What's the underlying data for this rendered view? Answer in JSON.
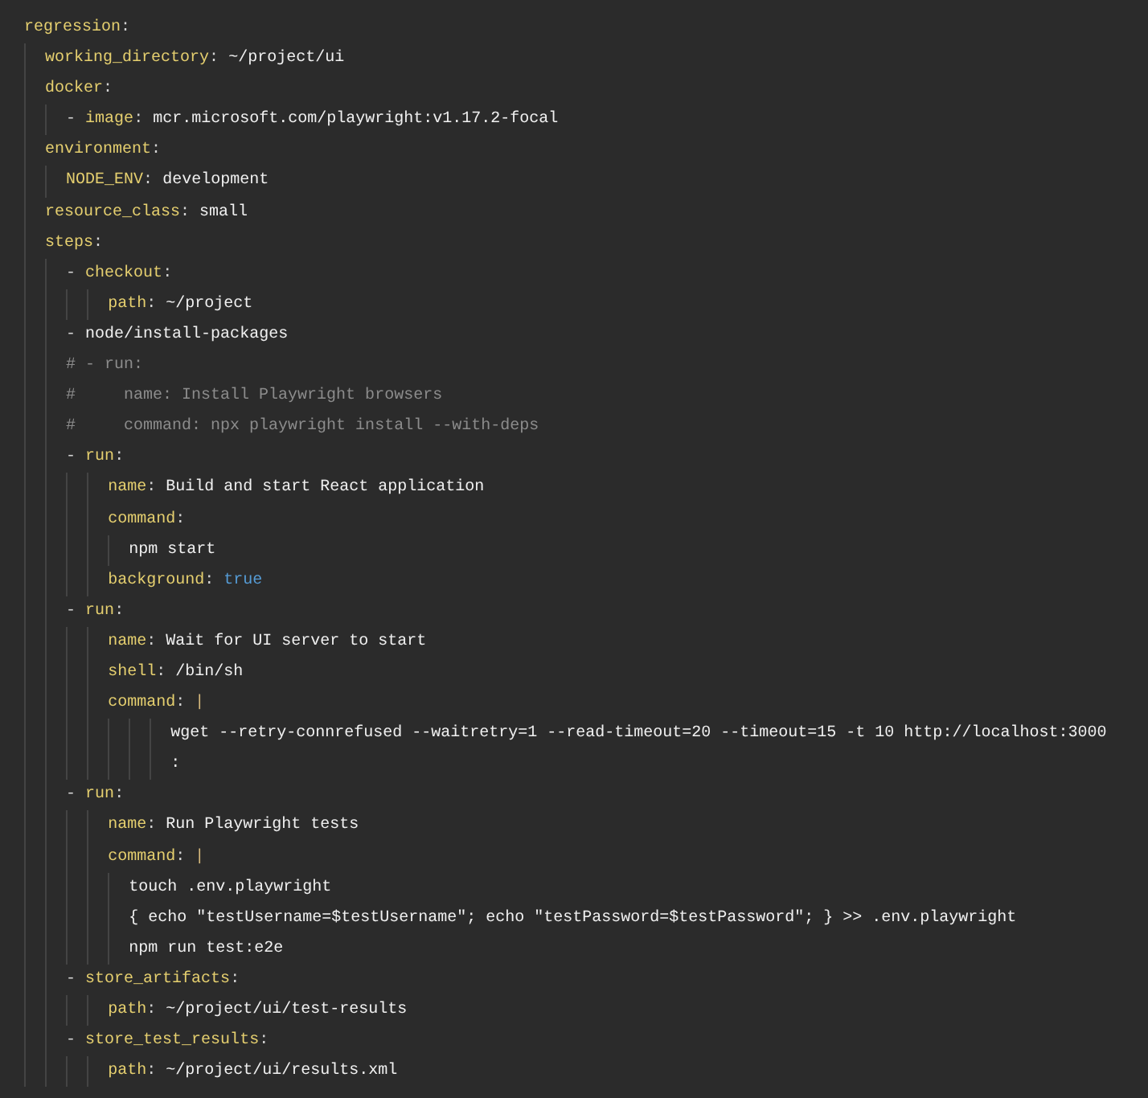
{
  "editor": {
    "lines": [
      [
        {
          "kind": "key",
          "text": "regression"
        },
        {
          "kind": "punct",
          "text": ":"
        }
      ],
      [
        {
          "kind": "key",
          "text": "  working_directory"
        },
        {
          "kind": "punct",
          "text": ": "
        },
        {
          "kind": "plain",
          "text": "~/project/ui"
        }
      ],
      [
        {
          "kind": "key",
          "text": "  docker"
        },
        {
          "kind": "punct",
          "text": ":"
        }
      ],
      [
        {
          "kind": "punct",
          "text": "    - "
        },
        {
          "kind": "key",
          "text": "image"
        },
        {
          "kind": "punct",
          "text": ": "
        },
        {
          "kind": "plain",
          "text": "mcr.microsoft.com/playwright:v1.17.2-focal"
        }
      ],
      [
        {
          "kind": "key",
          "text": "  environment"
        },
        {
          "kind": "punct",
          "text": ":"
        }
      ],
      [
        {
          "kind": "key",
          "text": "    NODE_ENV"
        },
        {
          "kind": "punct",
          "text": ": "
        },
        {
          "kind": "plain",
          "text": "development"
        }
      ],
      [
        {
          "kind": "key",
          "text": "  resource_class"
        },
        {
          "kind": "punct",
          "text": ": "
        },
        {
          "kind": "plain",
          "text": "small"
        }
      ],
      [
        {
          "kind": "key",
          "text": "  steps"
        },
        {
          "kind": "punct",
          "text": ":"
        }
      ],
      [
        {
          "kind": "punct",
          "text": "    - "
        },
        {
          "kind": "key",
          "text": "checkout"
        },
        {
          "kind": "punct",
          "text": ":"
        }
      ],
      [
        {
          "kind": "key",
          "text": "        path"
        },
        {
          "kind": "punct",
          "text": ": "
        },
        {
          "kind": "plain",
          "text": "~/project"
        }
      ],
      [
        {
          "kind": "punct",
          "text": "    - "
        },
        {
          "kind": "plain",
          "text": "node/install-packages"
        }
      ],
      [
        {
          "kind": "comment",
          "text": "    # - run:"
        }
      ],
      [
        {
          "kind": "comment",
          "text": "    #     name: Install Playwright browsers"
        }
      ],
      [
        {
          "kind": "comment",
          "text": "    #     command: npx playwright install --with-deps"
        }
      ],
      [
        {
          "kind": "punct",
          "text": "    - "
        },
        {
          "kind": "key",
          "text": "run"
        },
        {
          "kind": "punct",
          "text": ":"
        }
      ],
      [
        {
          "kind": "key",
          "text": "        name"
        },
        {
          "kind": "punct",
          "text": ": "
        },
        {
          "kind": "plain",
          "text": "Build and start React application"
        }
      ],
      [
        {
          "kind": "key",
          "text": "        command"
        },
        {
          "kind": "punct",
          "text": ":"
        }
      ],
      [
        {
          "kind": "plain",
          "text": "          npm start"
        }
      ],
      [
        {
          "kind": "key",
          "text": "        background"
        },
        {
          "kind": "punct",
          "text": ": "
        },
        {
          "kind": "bool",
          "text": "true"
        }
      ],
      [
        {
          "kind": "punct",
          "text": "    - "
        },
        {
          "kind": "key",
          "text": "run"
        },
        {
          "kind": "punct",
          "text": ":"
        }
      ],
      [
        {
          "kind": "key",
          "text": "        name"
        },
        {
          "kind": "punct",
          "text": ": "
        },
        {
          "kind": "plain",
          "text": "Wait for UI server to start"
        }
      ],
      [
        {
          "kind": "key",
          "text": "        shell"
        },
        {
          "kind": "punct",
          "text": ": "
        },
        {
          "kind": "plain",
          "text": "/bin/sh"
        }
      ],
      [
        {
          "kind": "key",
          "text": "        command"
        },
        {
          "kind": "punct",
          "text": ": "
        },
        {
          "kind": "pipe",
          "text": "|"
        }
      ],
      [
        {
          "kind": "plain",
          "text": "              wget --retry-connrefused --waitretry=1 --read-timeout=20 --timeout=15 -t 10 http://localhost:3000"
        }
      ],
      [
        {
          "kind": "plain",
          "text": "              :"
        }
      ],
      [
        {
          "kind": "punct",
          "text": "    - "
        },
        {
          "kind": "key",
          "text": "run"
        },
        {
          "kind": "punct",
          "text": ":"
        }
      ],
      [
        {
          "kind": "key",
          "text": "        name"
        },
        {
          "kind": "punct",
          "text": ": "
        },
        {
          "kind": "plain",
          "text": "Run Playwright tests"
        }
      ],
      [
        {
          "kind": "key",
          "text": "        command"
        },
        {
          "kind": "punct",
          "text": ": "
        },
        {
          "kind": "pipe",
          "text": "|"
        }
      ],
      [
        {
          "kind": "plain",
          "text": "          touch .env.playwright"
        }
      ],
      [
        {
          "kind": "plain",
          "text": "          { echo \"testUsername=$testUsername\"; echo \"testPassword=$testPassword\"; } >> .env.playwright"
        }
      ],
      [
        {
          "kind": "plain",
          "text": "          npm run test:e2e"
        }
      ],
      [
        {
          "kind": "punct",
          "text": "    - "
        },
        {
          "kind": "key",
          "text": "store_artifacts"
        },
        {
          "kind": "punct",
          "text": ":"
        }
      ],
      [
        {
          "kind": "key",
          "text": "        path"
        },
        {
          "kind": "punct",
          "text": ": "
        },
        {
          "kind": "plain",
          "text": "~/project/ui/test-results"
        }
      ],
      [
        {
          "kind": "punct",
          "text": "    - "
        },
        {
          "kind": "key",
          "text": "store_test_results"
        },
        {
          "kind": "punct",
          "text": ":"
        }
      ],
      [
        {
          "kind": "key",
          "text": "        path"
        },
        {
          "kind": "punct",
          "text": ": "
        },
        {
          "kind": "plain",
          "text": "~/project/ui/results.xml"
        }
      ]
    ]
  }
}
